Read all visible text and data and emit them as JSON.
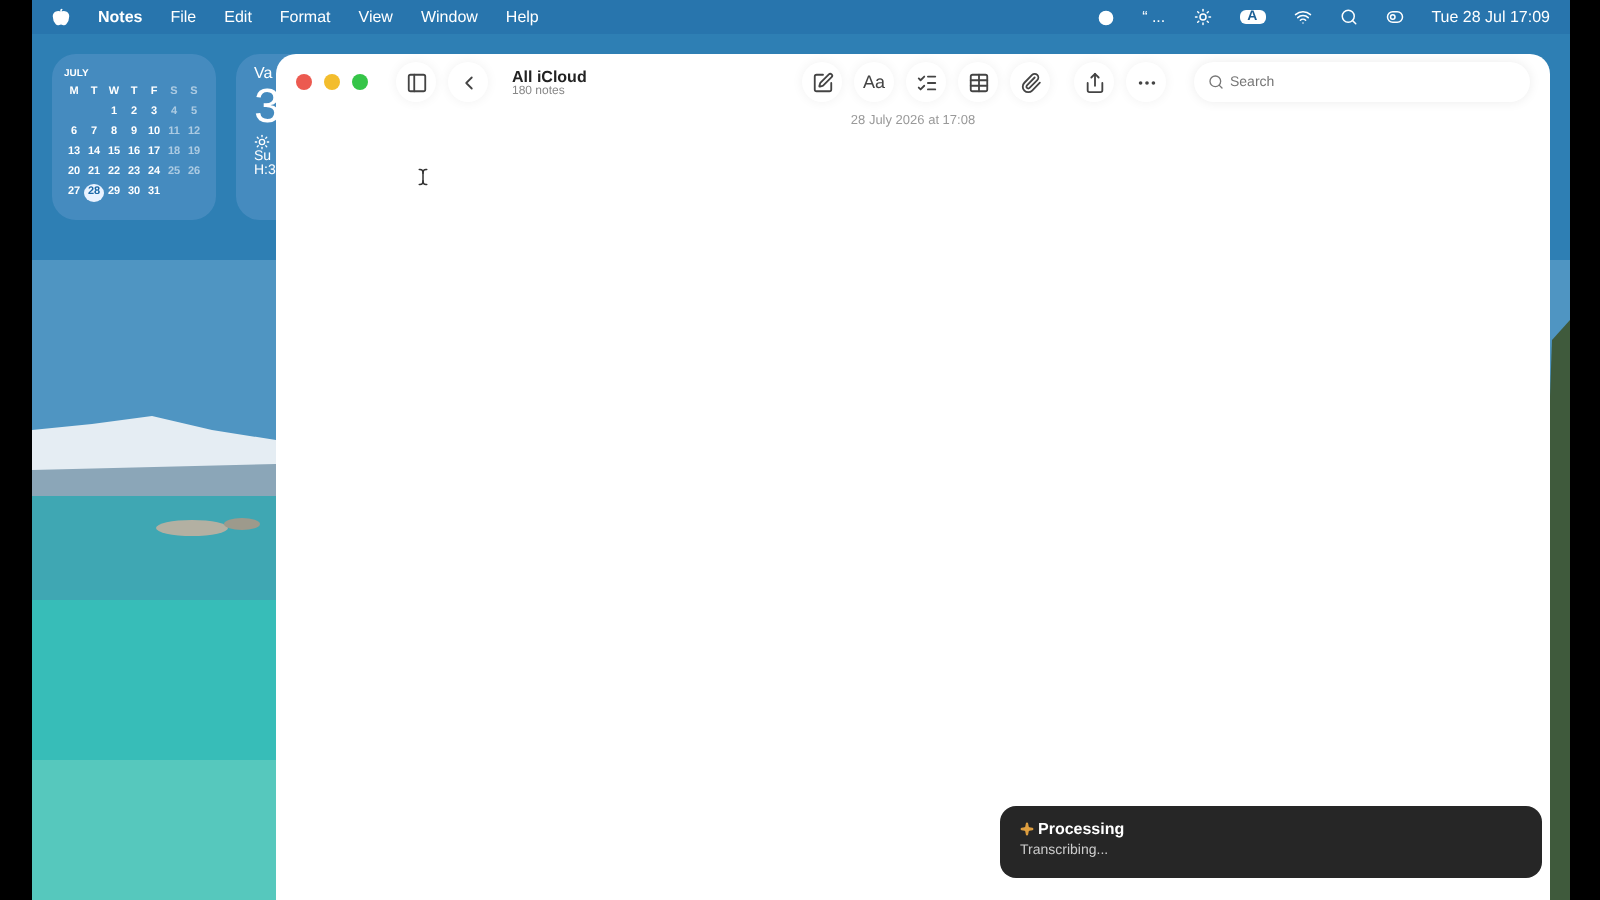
{
  "menu_bar": {
    "app": "Notes",
    "menus": [
      "File",
      "Edit",
      "Format",
      "View",
      "Window",
      "Help"
    ],
    "status_text": "“ ...",
    "input_badge": "A",
    "clock": "Tue 28 Jul  17:09"
  },
  "calendar_widget": {
    "month": "JULY",
    "weekdays": [
      "M",
      "T",
      "W",
      "T",
      "F",
      "S",
      "S"
    ],
    "weeks": [
      [
        {
          "day": "1",
          "selected": false
        },
        {
          "day": "2",
          "selected": false
        },
        {
          "day": "3",
          "selected": false
        },
        {
          "day": "4",
          "selected": false
        },
        {
          "day": "5",
          "selected": false
        }
      ],
      [
        {
          "day": "6",
          "selected": false
        },
        {
          "day": "7",
          "selected": false
        },
        {
          "day": "8",
          "selected": false
        },
        {
          "day": "9",
          "selected": false
        },
        {
          "day": "10",
          "selected": false
        },
        {
          "day": "11",
          "selected": false
        },
        {
          "day": "12",
          "selected": false
        }
      ],
      [
        {
          "day": "13",
          "selected": false
        },
        {
          "day": "14",
          "selected": false
        },
        {
          "day": "15",
          "selected": false
        },
        {
          "day": "16",
          "selected": false
        },
        {
          "day": "17",
          "selected": false
        },
        {
          "day": "18",
          "selected": false
        },
        {
          "day": "19",
          "selected": false
        }
      ],
      [
        {
          "day": "20",
          "selected": false
        },
        {
          "day": "21",
          "selected": false
        },
        {
          "day": "22",
          "selected": false
        },
        {
          "day": "23",
          "selected": false
        },
        {
          "day": "24",
          "selected": false
        },
        {
          "day": "25",
          "selected": false
        },
        {
          "day": "26",
          "selected": false
        }
      ],
      [
        {
          "day": "27",
          "selected": false
        },
        {
          "day": "28",
          "selected": true
        },
        {
          "day": "29",
          "selected": false
        },
        {
          "day": "30",
          "selected": false
        },
        {
          "day": "31",
          "selected": false
        }
      ]
    ]
  },
  "weather_widget": {
    "place": "Va",
    "temperature": "3",
    "condition": "Su",
    "high": "H:3"
  },
  "window": {
    "folder": "All iCloud",
    "count": "180 notes",
    "search": {
      "placeholder": "Search"
    },
    "note_date": "28 July 2026 at 17:08",
    "format_button": "Aa"
  },
  "toast": {
    "title": "Processing",
    "message": "Transcribing..."
  }
}
